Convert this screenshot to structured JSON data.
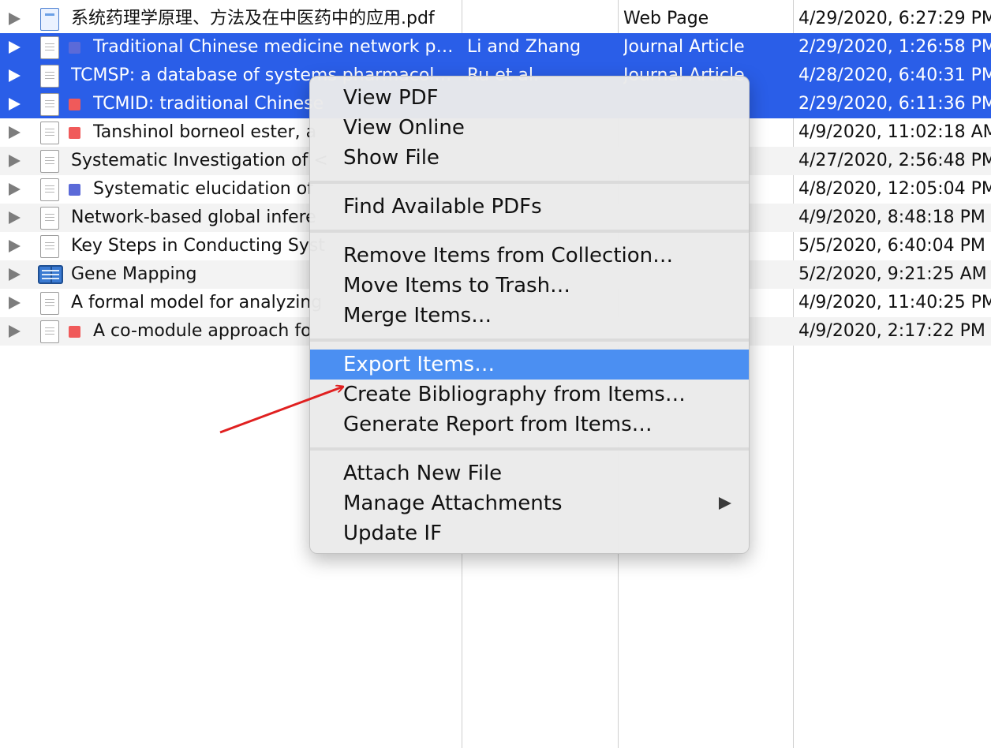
{
  "rows": [
    {
      "title": "系统药理学原理、方法及在中医药中的应用.pdf",
      "creator": "",
      "type": "Web Page",
      "date": "4/29/2020, 6:27:29 PM",
      "icon": "web-page-icon",
      "tag_color": null,
      "selected": false
    },
    {
      "title": "Traditional Chinese medicine network pharmacology: theory, methodology and application",
      "creator": "Li and Zhang",
      "type": "Journal Article",
      "date": "2/29/2020, 1:26:58 PM",
      "icon": "document-icon",
      "tag_color": "#5b6ad8",
      "selected": true
    },
    {
      "title": "TCMSP: a database of systems pharmacology",
      "creator": "Ru et al.",
      "type": "Journal Article",
      "date": "4/28/2020, 6:40:31 PM",
      "icon": "document-icon",
      "tag_color": null,
      "selected": true
    },
    {
      "title": "TCMID: traditional Chinese",
      "creator": "",
      "type": "",
      "date": "2/29/2020, 6:11:36 PM",
      "icon": "document-icon",
      "tag_color": "#f05a5a",
      "selected": true
    },
    {
      "title": "Tanshinol borneol ester, a",
      "creator": "",
      "type": "",
      "date": "4/9/2020, 11:02:18 AM",
      "icon": "document-icon",
      "tag_color": "#f05a5a",
      "selected": false
    },
    {
      "title": "Systematic Investigation of <",
      "creator": "",
      "type": "",
      "date": "4/27/2020, 2:56:48 PM",
      "icon": "document-icon",
      "tag_color": null,
      "selected": false
    },
    {
      "title": "Systematic elucidation of",
      "creator": "",
      "type": "",
      "date": "4/8/2020, 12:05:04 PM",
      "icon": "document-icon",
      "tag_color": "#5b6ad8",
      "selected": false
    },
    {
      "title": "Network-based global infere",
      "creator": "",
      "type": "",
      "date": "4/9/2020, 8:48:18 PM",
      "icon": "document-icon",
      "tag_color": null,
      "selected": false
    },
    {
      "title": "Key Steps in Conducting Syst",
      "creator": "",
      "type": "",
      "date": "5/5/2020, 6:40:04 PM",
      "icon": "document-icon",
      "tag_color": null,
      "selected": false
    },
    {
      "title": "Gene Mapping",
      "creator": "",
      "type": "",
      "date": "5/2/2020, 9:21:25 AM",
      "icon": "book-icon",
      "tag_color": null,
      "selected": false
    },
    {
      "title": "A formal model for analyzing",
      "creator": "",
      "type": "",
      "date": "4/9/2020, 11:40:25 PM",
      "icon": "document-icon",
      "tag_color": null,
      "selected": false
    },
    {
      "title": "A co-module approach fo",
      "creator": "",
      "type": "",
      "date": "4/9/2020, 2:17:22 PM",
      "icon": "document-icon",
      "tag_color": "#f05a5a",
      "selected": false
    }
  ],
  "context_menu": {
    "view_pdf": "View PDF",
    "view_online": "View Online",
    "show_file": "Show File",
    "find_pdfs": "Find Available PDFs",
    "remove_from_collection": "Remove Items from Collection…",
    "move_to_trash": "Move Items to Trash…",
    "merge_items": "Merge Items…",
    "export_items": "Export Items…",
    "create_bibliography": "Create Bibliography from Items…",
    "generate_report": "Generate Report from Items…",
    "attach_new_file": "Attach New File",
    "manage_attachments": "Manage Attachments",
    "update_if": "Update IF"
  },
  "colors": {
    "selection": "#2a5ee8",
    "menu_highlight": "#4b8ff2",
    "annotation_arrow": "#e02020"
  }
}
